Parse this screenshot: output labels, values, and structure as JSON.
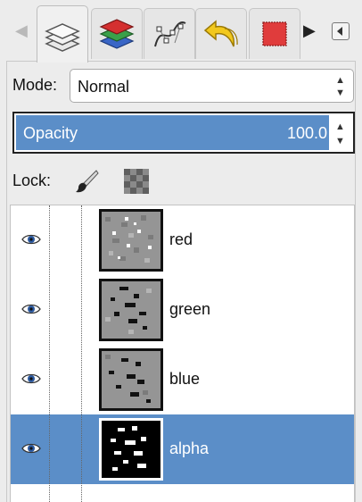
{
  "tabs": [
    {
      "name": "layers-tab-icon",
      "active": true
    },
    {
      "name": "channels-tab-icon",
      "active": false
    },
    {
      "name": "paths-tab-icon",
      "active": false
    },
    {
      "name": "undo-history-tab-icon",
      "active": false
    },
    {
      "name": "colormap-tab-icon",
      "active": false
    }
  ],
  "mode": {
    "label": "Mode:",
    "value": "Normal"
  },
  "opacity": {
    "label": "Opacity",
    "value": "100.0",
    "fraction": 1.0
  },
  "lock": {
    "label": "Lock:",
    "icons": [
      "lock-pixels-icon",
      "lock-alpha-icon"
    ]
  },
  "layers": [
    {
      "name": "red",
      "visible": true,
      "selected": false
    },
    {
      "name": "green",
      "visible": true,
      "selected": false
    },
    {
      "name": "blue",
      "visible": true,
      "selected": false
    },
    {
      "name": "alpha",
      "visible": true,
      "selected": true
    }
  ],
  "colors": {
    "selection": "#5b8ec8"
  }
}
